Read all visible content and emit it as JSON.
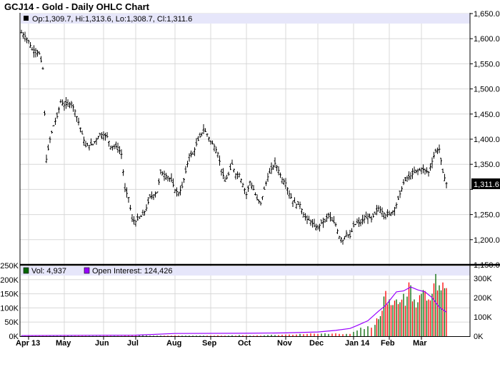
{
  "chart_data": {
    "type": "ohlc",
    "title": "GCJ14 - Gold - Daily OHLC Chart",
    "legend_price": "Op:1,309.7, Hi:1,313.6, Lo:1,308.7, Cl:1,311.6",
    "last_price_tag": "1,311.6",
    "price_axis": {
      "min": 1150,
      "max": 1650,
      "ticks": [
        "1,650.0",
        "1,600.0",
        "1,550.0",
        "1,500.0",
        "1,450.0",
        "1,400.0",
        "1,350.0",
        "1,300.0",
        "1,250.0",
        "1,200.0",
        "1,150.0"
      ],
      "tick_values": [
        1650,
        1600,
        1550,
        1500,
        1450,
        1400,
        1350,
        1300,
        1250,
        1200,
        1150
      ]
    },
    "x_ticks": [
      "Apr 13",
      "May",
      "Jun",
      "Jul",
      "Aug",
      "Sep",
      "Oct",
      "Nov",
      "Dec",
      "Jan 14",
      "Feb",
      "Mar"
    ],
    "x_tick_index": [
      2,
      12,
      23,
      32,
      43,
      53,
      63,
      74,
      83,
      93,
      103,
      112
    ],
    "closes": [
      1612,
      1605,
      1595,
      1578,
      1577,
      1570,
      1540,
      1360,
      1400,
      1427,
      1445,
      1475,
      1468,
      1470,
      1472,
      1456,
      1434,
      1410,
      1386,
      1388,
      1390,
      1400,
      1410,
      1408,
      1405,
      1386,
      1386,
      1384,
      1370,
      1300,
      1284,
      1240,
      1236,
      1243,
      1249,
      1263,
      1285,
      1289,
      1295,
      1334,
      1330,
      1325,
      1318,
      1299,
      1292,
      1305,
      1335,
      1368,
      1370,
      1390,
      1405,
      1420,
      1410,
      1395,
      1386,
      1372,
      1340,
      1316,
      1330,
      1350,
      1330,
      1330,
      1310,
      1290,
      1315,
      1300,
      1280,
      1272,
      1300,
      1325,
      1340,
      1352,
      1338,
      1320,
      1313,
      1291,
      1277,
      1270,
      1270,
      1250,
      1240,
      1237,
      1227,
      1223,
      1234,
      1237,
      1250,
      1237,
      1230,
      1206,
      1199,
      1213,
      1206,
      1227,
      1234,
      1234,
      1241,
      1246,
      1241,
      1251,
      1263,
      1256,
      1249,
      1251,
      1256,
      1270,
      1291,
      1313,
      1323,
      1327,
      1334,
      1337,
      1341,
      1338,
      1334,
      1356,
      1377,
      1380,
      1334,
      1312
    ],
    "volume_legend": "Vol: 4,937",
    "oi_legend": "Open Interest: 124,426",
    "volume_axis": {
      "max_k": 250,
      "ticks": [
        "250K",
        "200K",
        "150K",
        "100K",
        "50K",
        "0K"
      ],
      "tick_values": [
        250,
        200,
        150,
        100,
        50,
        0
      ]
    },
    "oi_axis": {
      "max_k": 370,
      "ticks": [
        "300K",
        "200K",
        "100K",
        "0K"
      ],
      "tick_values": [
        300,
        200,
        100,
        0
      ]
    },
    "volume_k": [
      1,
      1,
      1,
      1,
      1,
      1,
      1,
      1,
      1,
      1,
      1,
      1,
      1,
      2,
      1,
      1,
      1,
      1,
      1,
      1,
      1,
      1,
      1,
      1,
      1,
      1,
      1,
      1,
      1,
      2,
      2,
      2,
      2,
      4,
      6,
      3,
      2,
      2,
      2,
      2,
      2,
      2,
      2,
      3,
      2,
      2,
      2,
      2,
      2,
      2,
      2,
      2,
      2,
      2,
      2,
      3,
      2,
      2,
      2,
      3,
      2,
      4,
      3,
      3,
      2,
      2,
      3,
      2,
      3,
      4,
      5,
      4,
      4,
      5,
      6,
      6,
      5,
      6,
      8,
      7,
      8,
      10,
      9,
      8,
      9,
      10,
      8,
      9,
      10,
      8,
      7,
      8,
      8,
      15,
      20,
      30,
      25,
      35,
      30,
      40,
      60,
      90,
      160,
      130,
      110,
      130,
      120,
      150,
      140,
      180,
      130,
      120,
      150,
      160,
      130,
      150,
      220,
      180,
      190,
      170
    ],
    "oi_points_index": [
      0,
      32,
      43,
      64,
      74,
      83,
      88,
      92,
      94,
      97,
      100,
      102,
      105,
      107,
      109,
      111,
      113,
      115,
      117,
      119
    ],
    "oi_points_k": [
      3,
      5,
      14,
      15,
      17,
      22,
      30,
      40,
      55,
      80,
      130,
      160,
      230,
      235,
      255,
      240,
      230,
      200,
      150,
      124.4
    ],
    "colors": {
      "up": "#006600",
      "down": "#ff0000",
      "oi": "#9900ff",
      "legend_band": "#e6e6fa",
      "grid": "#d8d8d8"
    }
  }
}
